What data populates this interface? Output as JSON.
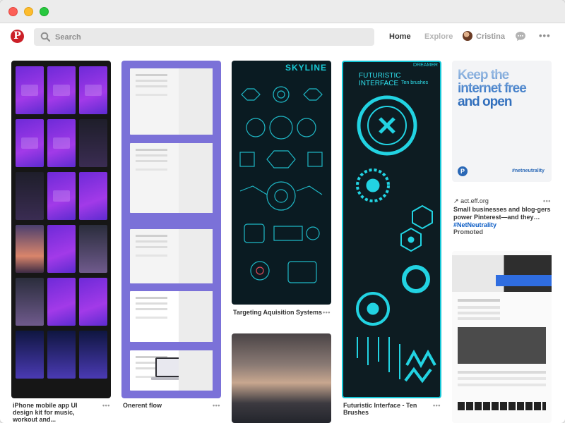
{
  "window": {
    "controls": [
      "close",
      "minimize",
      "zoom"
    ]
  },
  "header": {
    "logo": "P",
    "search_placeholder": "Search",
    "nav_home": "Home",
    "nav_explore": "Explore",
    "profile_name": "Cristina",
    "more": "•••"
  },
  "pins": [
    {
      "title": "iPhone mobile app UI design kit for music, workout and...",
      "more": "•••"
    },
    {
      "title": "Onerent flow",
      "more": "•••"
    },
    {
      "title": "Targeting Aquisition Systems",
      "more": "•••",
      "image_text": "SKYLINE"
    },
    {
      "title": "Futuristic Interface - Ten Brushes",
      "more": "•••",
      "image_text": "FUTURISTIC INTERFACE",
      "image_subtext": "Ten brushes",
      "image_corner": "DREAMER"
    },
    {
      "image_text": "Keep the internet free and open",
      "image_tag": "#netneutrality",
      "source": "act.eff.org",
      "body_prefix": "Small businesses and blog-gers power Pinterest—and they… ",
      "body_link": "#NetNeutrality",
      "label": "Promoted",
      "more": "•••"
    }
  ],
  "colors": {
    "brand": "#cb1f27",
    "link": "#0b5cc5",
    "cyan": "#16c6d6",
    "purple": "#7b71d8"
  }
}
